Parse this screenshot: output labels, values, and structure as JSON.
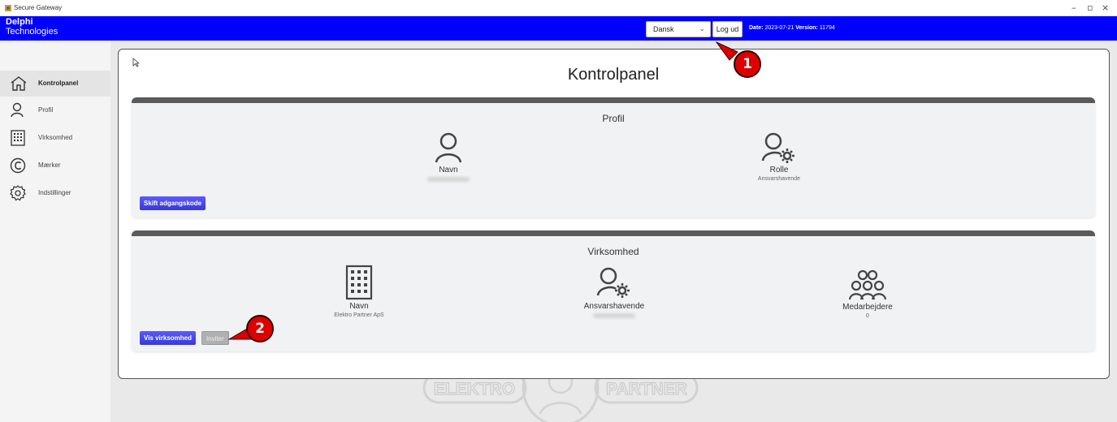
{
  "window": {
    "title": "Secure Gateway"
  },
  "header": {
    "brand_line1": "Delphi",
    "brand_line2": "Technologies",
    "language": "Dansk",
    "logout_label": "Log ud",
    "date_label": "Date:",
    "date_value": "2023-07-21",
    "version_label": "Version:",
    "version_value": "11794"
  },
  "sidebar": {
    "items": [
      {
        "label": "Kontrolpanel",
        "icon": "home-icon",
        "active": true
      },
      {
        "label": "Profil",
        "icon": "person-icon"
      },
      {
        "label": "Virksomhed",
        "icon": "building-icon"
      },
      {
        "label": "Mærker",
        "icon": "copyright-icon"
      },
      {
        "label": "Indstillinger",
        "icon": "gear-icon"
      }
    ]
  },
  "main": {
    "title": "Kontrolpanel",
    "profile_card": {
      "title": "Profil",
      "name_label": "Navn",
      "role_label": "Rolle",
      "role_value": "Ansvarshavende",
      "change_password_label": "Skift adgangskode"
    },
    "company_card": {
      "title": "Virksomhed",
      "name_label": "Navn",
      "name_value": "Elektro Partner ApS",
      "responsible_label": "Ansvarshavende",
      "employees_label": "Medarbejdere",
      "employees_value": "0",
      "show_company_label": "Vis virksomhed",
      "invite_label": "Inviter"
    },
    "watermark": {
      "left_text": "ELEKTRO",
      "right_text": "PARTNER"
    }
  },
  "callouts": [
    "1",
    "2"
  ],
  "colors": {
    "header": "#0000ff",
    "callout": "#dd0000",
    "primary_button": "#4a4af0"
  }
}
